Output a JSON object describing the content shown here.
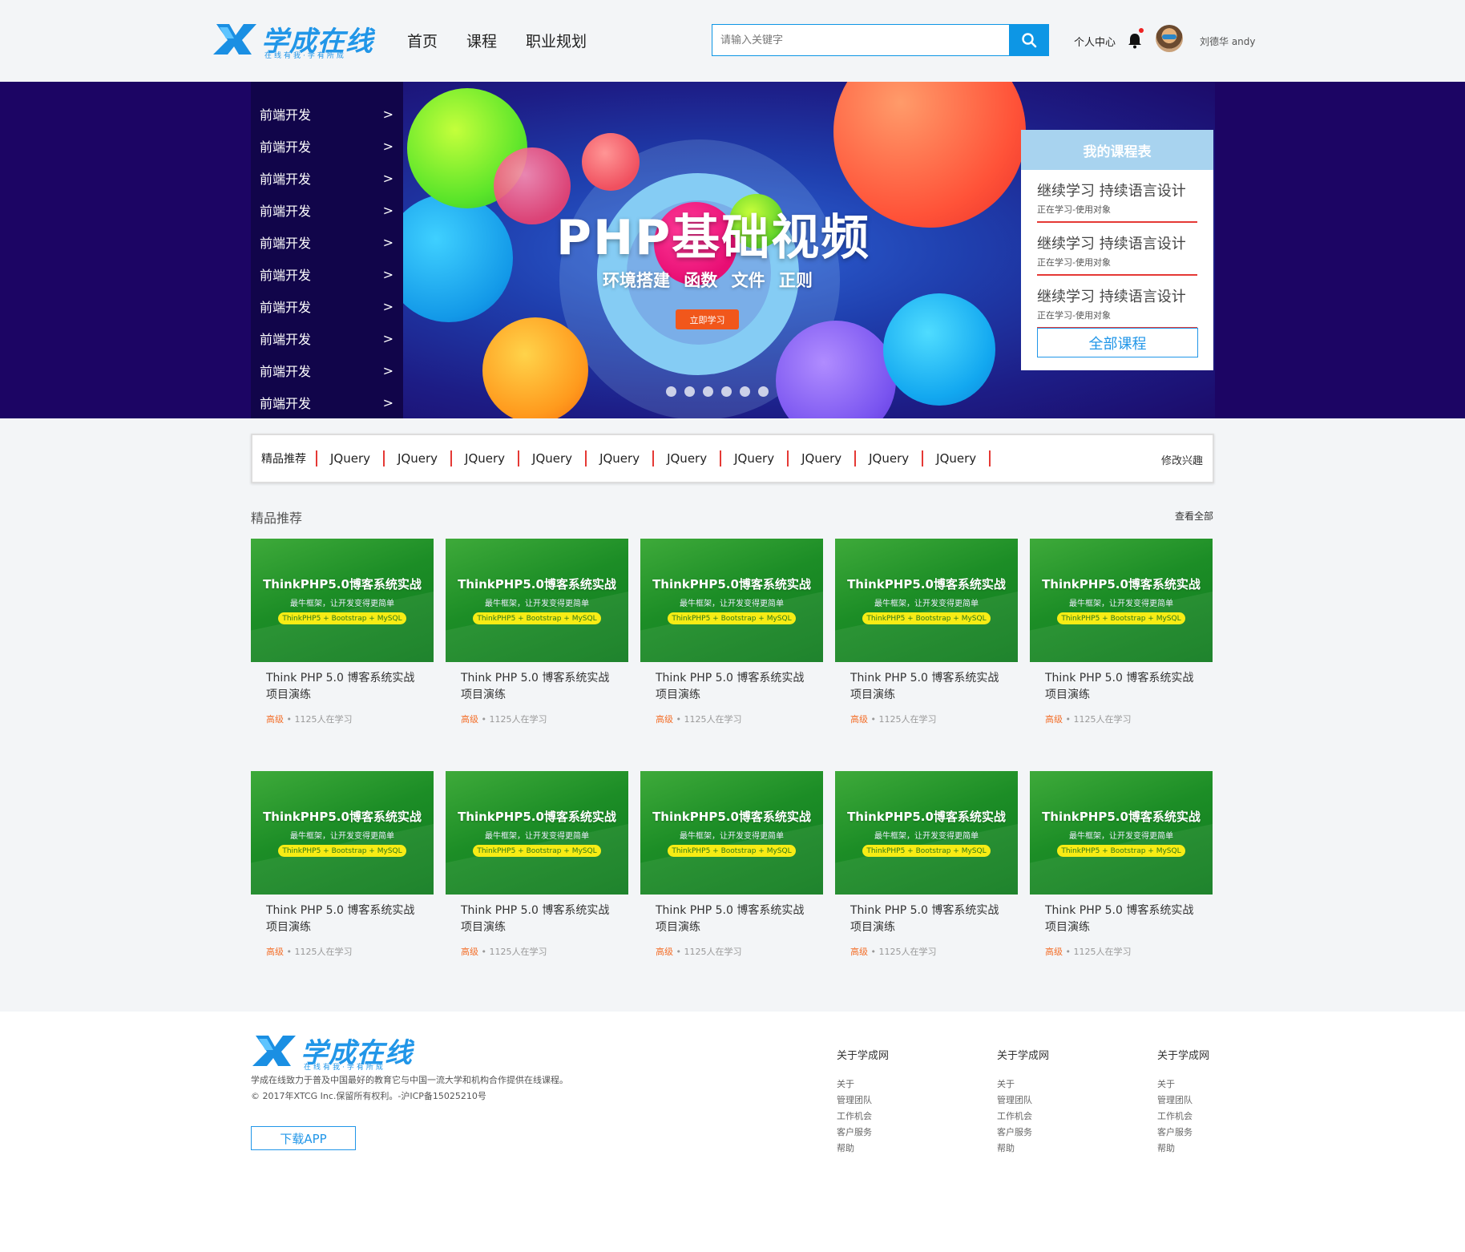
{
  "brand": {
    "name": "学成在线",
    "slogan": "在线有我·学有所成",
    "color": "#2196e8"
  },
  "header": {
    "nav": [
      "首页",
      "课程",
      "职业规划"
    ],
    "search_placeholder": "请输入关键字",
    "user_center": "个人中心",
    "username": "刘德华 andy",
    "has_notification": true
  },
  "sidebar": {
    "items": [
      {
        "label": "前端开发",
        "arrow": ">"
      },
      {
        "label": "前端开发",
        "arrow": ">"
      },
      {
        "label": "前端开发",
        "arrow": ">"
      },
      {
        "label": "前端开发",
        "arrow": ">"
      },
      {
        "label": "前端开发",
        "arrow": ">"
      },
      {
        "label": "前端开发",
        "arrow": ">"
      },
      {
        "label": "前端开发",
        "arrow": ">"
      },
      {
        "label": "前端开发",
        "arrow": ">"
      },
      {
        "label": "前端开发",
        "arrow": ">"
      },
      {
        "label": "前端开发",
        "arrow": ">"
      }
    ]
  },
  "banner": {
    "title": "PHP基础视频",
    "subtitle": "环境搭建 函数 文件 正则",
    "cta": "立即学习",
    "slide_count": 6
  },
  "schedule": {
    "title": "我的课程表",
    "items": [
      {
        "title": "继续学习 持续语言设计",
        "sub": "正在学习-使用对象"
      },
      {
        "title": "继续学习 持续语言设计",
        "sub": "正在学习-使用对象"
      },
      {
        "title": "继续学习 持续语言设计",
        "sub": "正在学习-使用对象"
      }
    ],
    "all_label": "全部课程"
  },
  "tagbar": {
    "label": "精品推荐",
    "tags": [
      "JQuery",
      "JQuery",
      "JQuery",
      "JQuery",
      "JQuery",
      "JQuery",
      "JQuery",
      "JQuery",
      "JQuery",
      "JQuery"
    ],
    "edit": "修改兴趣"
  },
  "section": {
    "title": "精品推荐",
    "see_all": "查看全部",
    "courses": [
      {
        "thumb_title": "ThinkPHP5.0博客系统实战",
        "thumb_sub": "最牛框架，让开发变得更简单",
        "thumb_pill": "ThinkPHP5 + Bootstrap + MySQL",
        "name": "Think PHP 5.0 博客系统实战项目演练",
        "level": "高级",
        "students": "• 1125人在学习"
      },
      {
        "thumb_title": "ThinkPHP5.0博客系统实战",
        "thumb_sub": "最牛框架，让开发变得更简单",
        "thumb_pill": "ThinkPHP5 + Bootstrap + MySQL",
        "name": "Think PHP 5.0 博客系统实战项目演练",
        "level": "高级",
        "students": "• 1125人在学习"
      },
      {
        "thumb_title": "ThinkPHP5.0博客系统实战",
        "thumb_sub": "最牛框架，让开发变得更简单",
        "thumb_pill": "ThinkPHP5 + Bootstrap + MySQL",
        "name": "Think PHP 5.0 博客系统实战项目演练",
        "level": "高级",
        "students": "• 1125人在学习"
      },
      {
        "thumb_title": "ThinkPHP5.0博客系统实战",
        "thumb_sub": "最牛框架，让开发变得更简单",
        "thumb_pill": "ThinkPHP5 + Bootstrap + MySQL",
        "name": "Think PHP 5.0 博客系统实战项目演练",
        "level": "高级",
        "students": "• 1125人在学习"
      },
      {
        "thumb_title": "ThinkPHP5.0博客系统实战",
        "thumb_sub": "最牛框架，让开发变得更简单",
        "thumb_pill": "ThinkPHP5 + Bootstrap + MySQL",
        "name": "Think PHP 5.0 博客系统实战项目演练",
        "level": "高级",
        "students": "• 1125人在学习"
      },
      {
        "thumb_title": "ThinkPHP5.0博客系统实战",
        "thumb_sub": "最牛框架，让开发变得更简单",
        "thumb_pill": "ThinkPHP5 + Bootstrap + MySQL",
        "name": "Think PHP 5.0 博客系统实战项目演练",
        "level": "高级",
        "students": "• 1125人在学习"
      },
      {
        "thumb_title": "ThinkPHP5.0博客系统实战",
        "thumb_sub": "最牛框架，让开发变得更简单",
        "thumb_pill": "ThinkPHP5 + Bootstrap + MySQL",
        "name": "Think PHP 5.0 博客系统实战项目演练",
        "level": "高级",
        "students": "• 1125人在学习"
      },
      {
        "thumb_title": "ThinkPHP5.0博客系统实战",
        "thumb_sub": "最牛框架，让开发变得更简单",
        "thumb_pill": "ThinkPHP5 + Bootstrap + MySQL",
        "name": "Think PHP 5.0 博客系统实战项目演练",
        "level": "高级",
        "students": "• 1125人在学习"
      },
      {
        "thumb_title": "ThinkPHP5.0博客系统实战",
        "thumb_sub": "最牛框架，让开发变得更简单",
        "thumb_pill": "ThinkPHP5 + Bootstrap + MySQL",
        "name": "Think PHP 5.0 博客系统实战项目演练",
        "level": "高级",
        "students": "• 1125人在学习"
      },
      {
        "thumb_title": "ThinkPHP5.0博客系统实战",
        "thumb_sub": "最牛框架，让开发变得更简单",
        "thumb_pill": "ThinkPHP5 + Bootstrap + MySQL",
        "name": "Think PHP 5.0 博客系统实战项目演练",
        "level": "高级",
        "students": "• 1125人在学习"
      }
    ]
  },
  "footer": {
    "desc_line1": "学成在线致力于普及中国最好的教育它与中国一流大学和机构合作提供在线课程。",
    "desc_line2": "© 2017年XTCG Inc.保留所有权利。-沪ICP备15025210号",
    "app_button": "下载APP",
    "columns": [
      {
        "heading": "关于学成网",
        "links": [
          "关于",
          "管理团队",
          "工作机会",
          "客户服务",
          "帮助"
        ]
      },
      {
        "heading": "关于学成网",
        "links": [
          "关于",
          "管理团队",
          "工作机会",
          "客户服务",
          "帮助"
        ]
      },
      {
        "heading": "关于学成网",
        "links": [
          "关于",
          "管理团队",
          "工作机会",
          "客户服务",
          "帮助"
        ]
      }
    ]
  },
  "colors": {
    "accent": "#0d96e5",
    "banner_bg": "#1c0564",
    "sidebar_bg": "#11054a",
    "divider_red": "#e53935",
    "level_orange": "#f36f2a",
    "card_green": "#1c8d26"
  }
}
